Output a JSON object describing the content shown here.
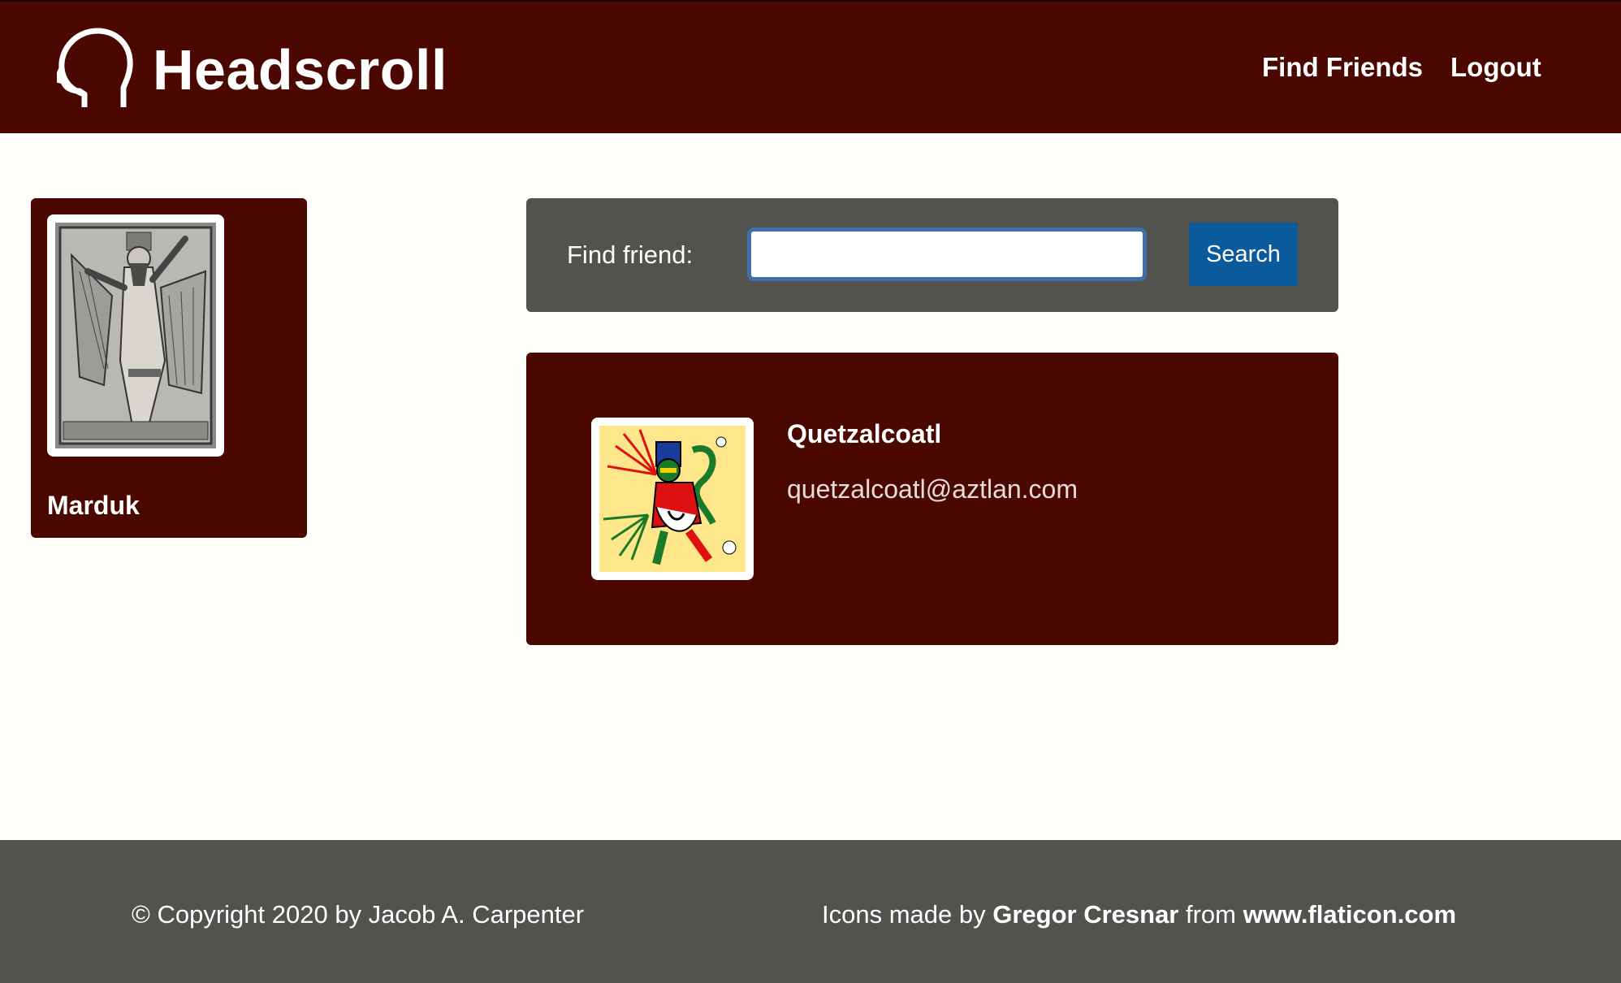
{
  "header": {
    "brand": "Headscroll",
    "logo_icon": "head-outline-icon",
    "nav": {
      "find_friends": "Find Friends",
      "logout": "Logout"
    },
    "background_color": "#4a0800"
  },
  "profile": {
    "name": "Marduk",
    "photo_icon": "assyrian-relief-image"
  },
  "search": {
    "label": "Find friend:",
    "value": "",
    "button_label": "Search",
    "button_color": "#0a5a9c"
  },
  "results": [
    {
      "name": "Quetzalcoatl",
      "email": "quetzalcoatl@aztlan.com",
      "photo_icon": "aztec-codex-image"
    }
  ],
  "footer": {
    "copyright": "© Copyright 2020 by Jacob A. Carpenter",
    "credit_prefix": "Icons made by",
    "credit_author": "Gregor Cresnar",
    "credit_mid": "from",
    "credit_site": "www.flaticon.com"
  }
}
